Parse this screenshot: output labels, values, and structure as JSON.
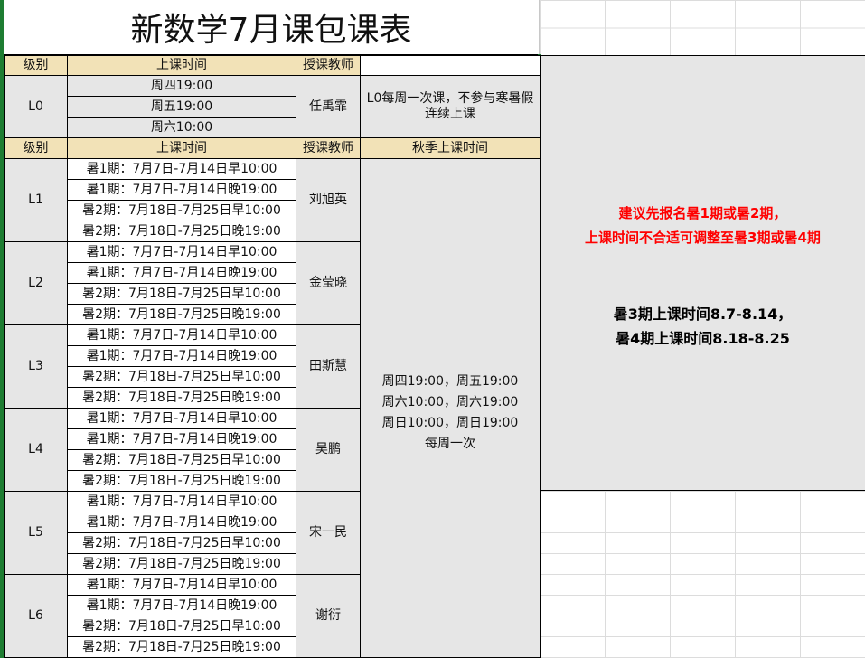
{
  "title": "新数学7月课包课表",
  "header": {
    "level": "级别",
    "time": "上课时间",
    "teacher": "授课教师",
    "fall": "秋季上课时间"
  },
  "l0": {
    "level": "L0",
    "times": [
      "周四19:00",
      "周五19:00",
      "周六10:00"
    ],
    "teacher": "任禹霏",
    "note": "L0每周一次课，不参与寒暑假连续上课"
  },
  "sessions": [
    "暑1期：7月7日-7月14日早10:00",
    "暑1期：7月7日-7月14日晚19:00",
    "暑2期：7月18日-7月25日早10:00",
    "暑2期：7月18日-7月25日晚19:00"
  ],
  "groups": [
    {
      "level": "L1",
      "teacher": "刘旭英"
    },
    {
      "level": "L2",
      "teacher": "金莹晓"
    },
    {
      "level": "L3",
      "teacher": "田斯慧"
    },
    {
      "level": "L4",
      "teacher": "吴鹏"
    },
    {
      "level": "L5",
      "teacher": "宋一民"
    },
    {
      "level": "L6",
      "teacher": "谢衍"
    }
  ],
  "fall_time": [
    "周四19:00，周五19:00",
    "周六10:00，周六19:00",
    "周日10:00，周日19:00",
    "每周一次"
  ],
  "notes": {
    "red_line1": "建议先报名暑1期或暑2期，",
    "red_line2": "上课时间不合适可调整至暑3期或暑4期",
    "black_line1": "暑3期上课时间8.7-8.14，",
    "black_line2": "暑4期上课时间8.18-8.25"
  },
  "colors": {
    "header_bg": "#f2e2b7",
    "cell_bg": "#e6e6e6",
    "note_red": "#ff0000",
    "sheet_border": "#1e7d32"
  }
}
